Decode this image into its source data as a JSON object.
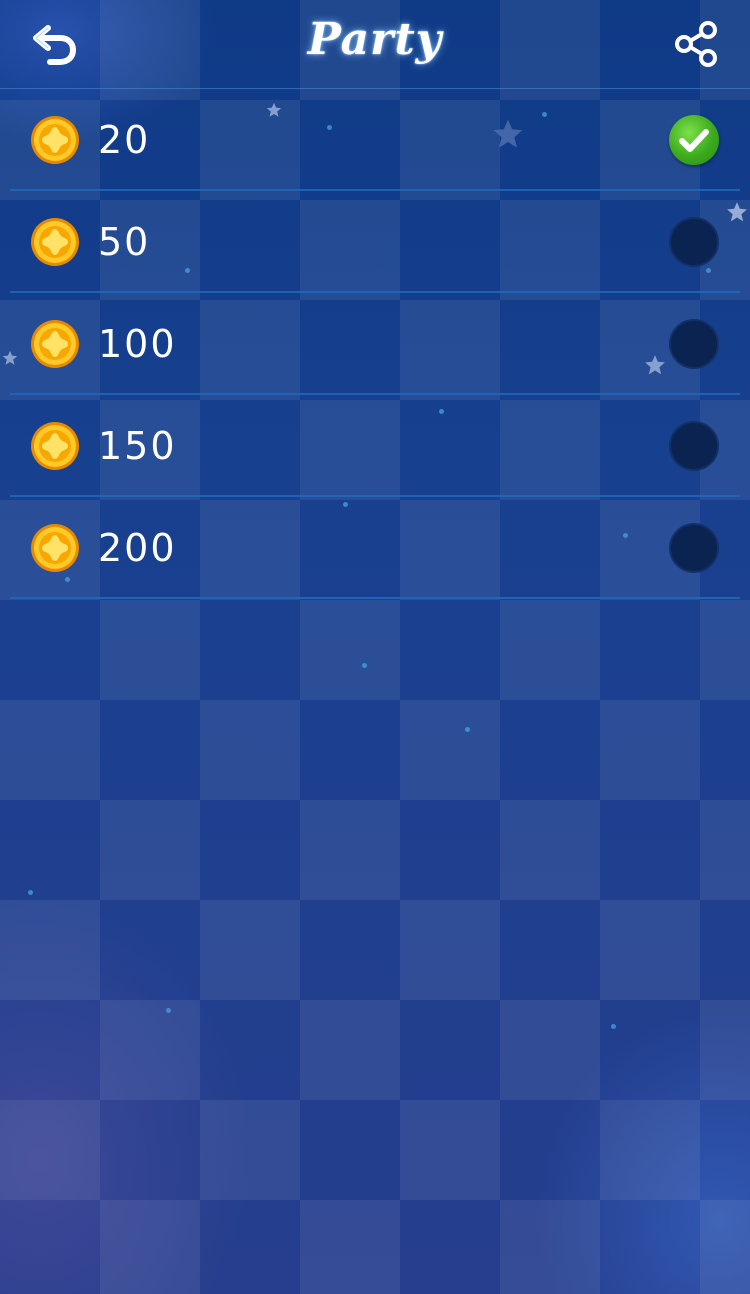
{
  "header": {
    "title": "Party",
    "back_icon": "back-arrow-icon",
    "share_icon": "share-icon"
  },
  "options": [
    {
      "amount": "20",
      "selected": true
    },
    {
      "amount": "50",
      "selected": false
    },
    {
      "amount": "100",
      "selected": false
    },
    {
      "amount": "150",
      "selected": false
    },
    {
      "amount": "200",
      "selected": false
    }
  ],
  "icons": {
    "coin": "coin-star-icon",
    "selected": "checkmark-icon"
  },
  "colors": {
    "background": "#17408f",
    "divider": "#1e6bbf",
    "coin": "#f5b400",
    "check": "#3dab1e",
    "radio_off": "#0b2350"
  }
}
